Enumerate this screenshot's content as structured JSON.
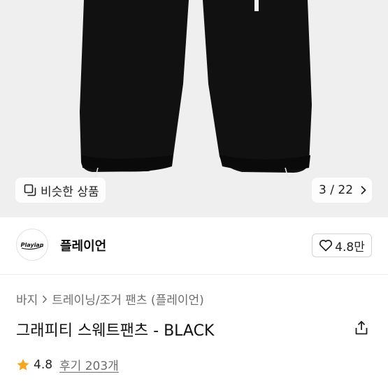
{
  "gallery": {
    "similar_label": "비슷한 상품",
    "current_index": "3",
    "total": "22"
  },
  "seller": {
    "name": "플레이언",
    "logo_text": "Playian",
    "like_count": "4.8만"
  },
  "breadcrumb": {
    "category": "바지",
    "subcategory": "트레이닝/조거 팬츠 (플레이언)"
  },
  "product": {
    "title": "그래피티 스웨트팬츠 - BLACK",
    "rating": "4.8",
    "reviews": "후기 203개"
  },
  "colors": {
    "star": "#f5a623",
    "hero_bg": "#efefef",
    "pants": "#111111"
  },
  "icons": {
    "similar": "similar-items-icon",
    "next": "chevron-right-icon",
    "like": "heart-icon",
    "breadcrumb_sep": "chevron-right-icon",
    "share": "share-icon",
    "star": "star-icon"
  }
}
